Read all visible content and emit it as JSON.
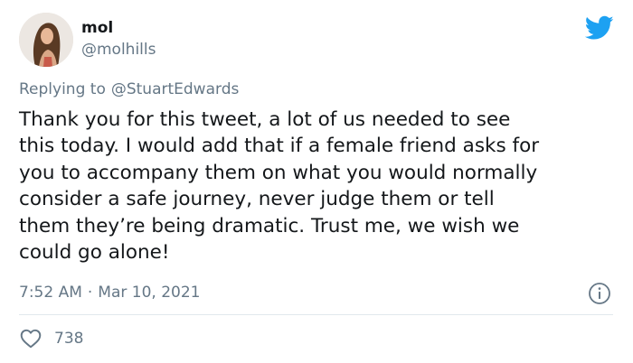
{
  "tweet": {
    "display_name": "mol",
    "handle": "@molhills",
    "reply_prefix": "Replying to",
    "reply_to": "@StuartEdwards",
    "text_lines": [
      "Thank you for this tweet, a lot of us needed to see",
      "this today. I would add that if a female friend asks for",
      "you to accompany them on what you would normally",
      "consider a safe journey, never judge them or tell",
      "them they’re being dramatic. Trust me, we wish we",
      "could go alone!"
    ],
    "time": "7:52 AM",
    "separator": "·",
    "date": "Mar 10, 2021",
    "like_count": "738"
  },
  "icons": {
    "brand": "twitter-bird-icon",
    "info": "info-icon",
    "like": "heart-icon"
  },
  "colors": {
    "twitter_blue": "#1DA1F2",
    "text_primary": "#14171A",
    "text_secondary": "#657786",
    "divider": "#E1E8ED"
  }
}
